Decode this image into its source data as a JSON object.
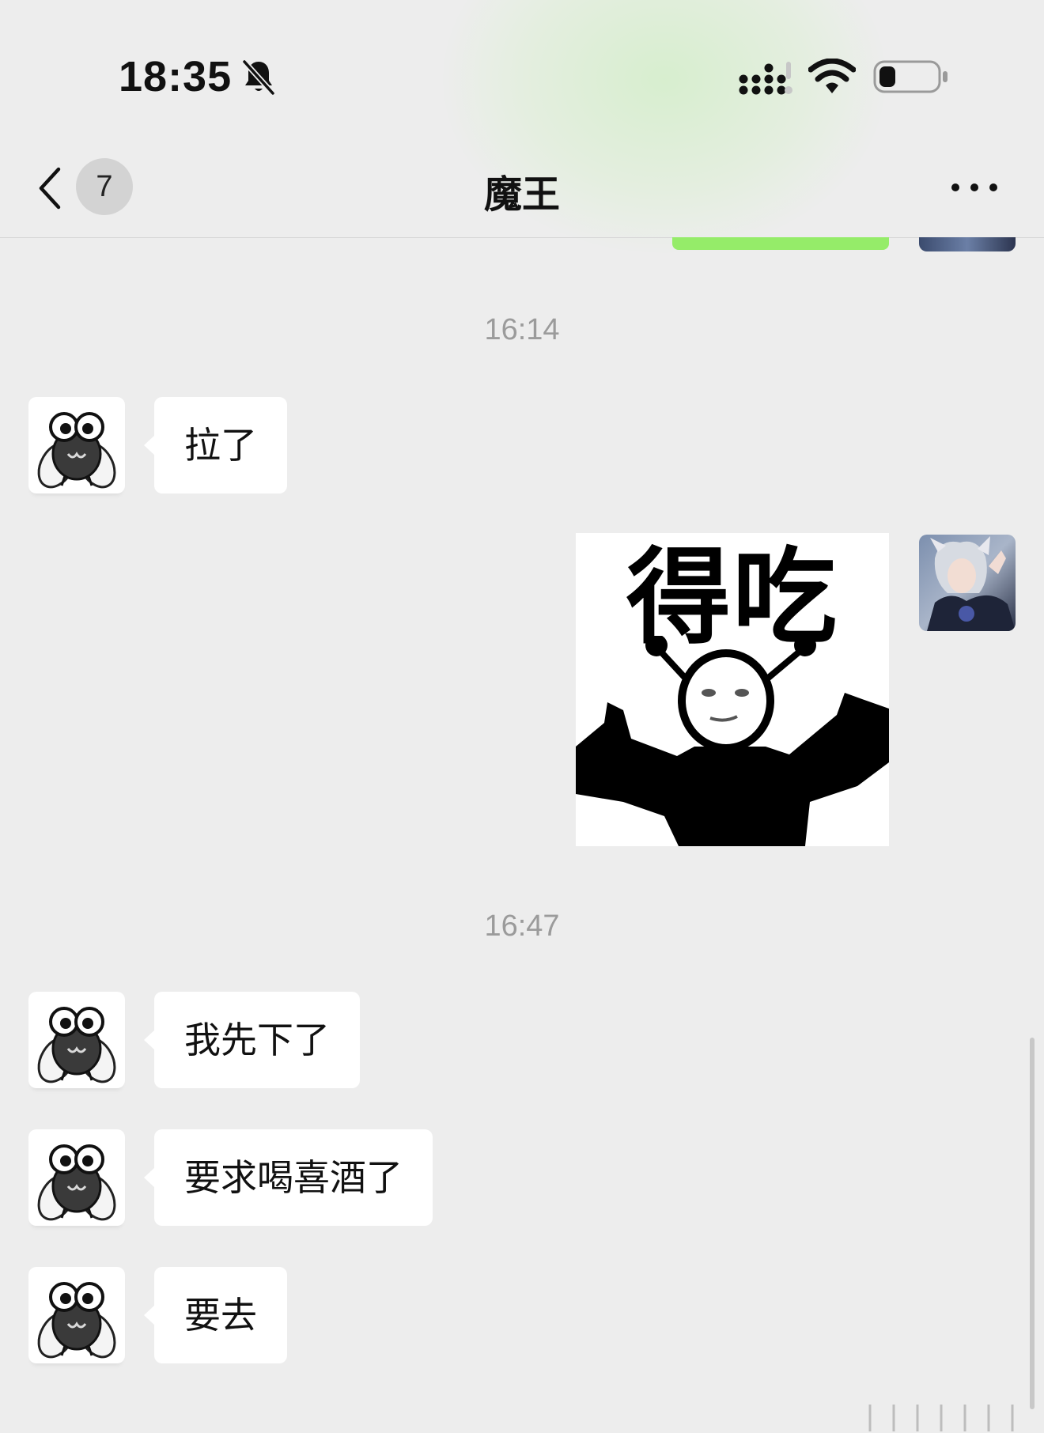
{
  "status_bar": {
    "time": "18:35",
    "mute_icon": "bell-slash-icon",
    "signal_icon": "cellular-signal-icon",
    "wifi_icon": "wifi-icon",
    "battery_icon": "battery-low-icon"
  },
  "nav": {
    "back_icon": "chevron-left-icon",
    "unread_count": "7",
    "title": "魔王",
    "more_icon": "ellipsis-icon"
  },
  "messages": {
    "timestamp_1": "16:14",
    "msg_1": "拉了",
    "sticker_text": "得吃",
    "timestamp_2": "16:47",
    "msg_2": "我先下了",
    "msg_3": "要求喝喜酒了",
    "msg_4": "要去"
  },
  "colors": {
    "background": "#ededed",
    "bubble_in": "#ffffff",
    "bubble_out": "#95ec69",
    "timestamp": "#9b9b9b"
  }
}
